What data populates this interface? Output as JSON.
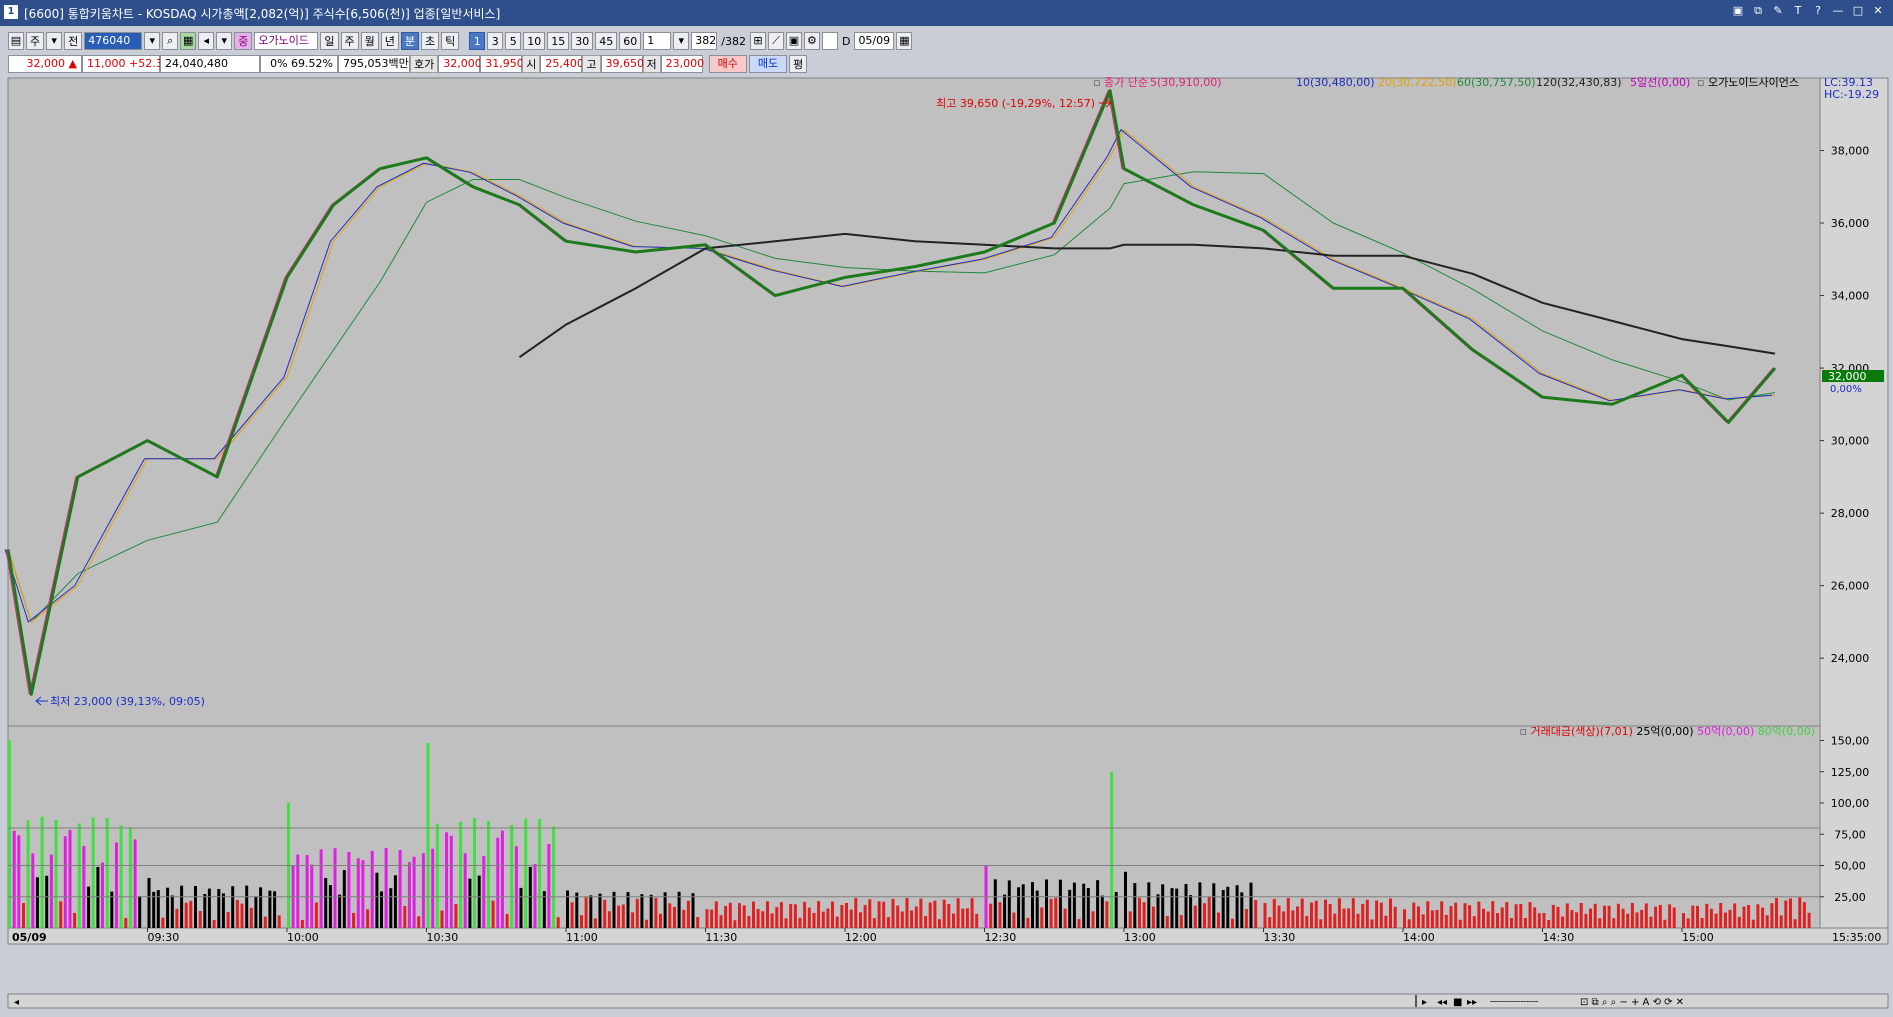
{
  "window": {
    "number": "1",
    "title": "[6600] 통합키움차트 - KOSDAQ 시가총액[2,082(억)] 주식수[6,506(천)] 업종[일반서비스]",
    "buttons": [
      "▣",
      "⧉",
      "✎",
      "T",
      "?",
      "—",
      "□",
      "✕"
    ]
  },
  "toolbar": {
    "period_select": "주",
    "prev_label": "전",
    "code": "476040",
    "name": "오가노이드",
    "badge": "중",
    "periods": [
      "일",
      "주",
      "월",
      "년",
      "분",
      "초",
      "틱"
    ],
    "selected_period": "분",
    "intervals": [
      "1",
      "3",
      "5",
      "10",
      "15",
      "30",
      "45",
      "60"
    ],
    "selected_interval": "1",
    "count_value": "1",
    "bar_count": "382",
    "bar_total": "/382",
    "date": "05/09",
    "checkbox_label": "D"
  },
  "quote": {
    "price": "32,000",
    "change": "11,000",
    "change_pct": "+52.38%",
    "volume": "24,040,480",
    "turnover_label": "0%",
    "turnover_pct": "69.52%",
    "amount": "795,053백만",
    "bid_label": "호가",
    "bid": "32,000",
    "ask": "31,950",
    "open_label": "시",
    "open": "25,400",
    "high_label": "고",
    "high": "39,650",
    "low_label": "저",
    "low": "23,000",
    "buy_label": "매수",
    "sell_label": "매도",
    "extra_label": "평"
  },
  "price_legend": {
    "prefix": "종가 단순",
    "items": [
      {
        "text": "5(30,910,00)",
        "color": "#e0207a"
      },
      {
        "text": "10(30,480,00)",
        "color": "#1a2ec8"
      },
      {
        "text": "20(30,722,50)",
        "color": "#e8a000"
      },
      {
        "text": "60(30,757,50)",
        "color": "#1f8a3c"
      },
      {
        "text": "120(32,430,83)",
        "color": "#222222"
      },
      {
        "text": "5일선(0,00)",
        "color": "#c000c0"
      },
      {
        "text": "오가노이드사이언스",
        "color": "#000000"
      }
    ],
    "lc": "LC:39.13",
    "hc": "HC:-19.29"
  },
  "volume_legend": {
    "items": [
      {
        "text": "거래대금(색상)(7,01)",
        "color": "#e00000"
      },
      {
        "text": "25억(0,00)",
        "color": "#000000"
      },
      {
        "text": "50억(0,00)",
        "color": "#e020e0"
      },
      {
        "text": "80억(0,00)",
        "color": "#40d040"
      }
    ]
  },
  "annotations": {
    "high": "최고 39,650 (-19,29%, 12:57)",
    "low": "최저 23,000 (39,13%, 09:05)",
    "last_price": "32,000",
    "last_pct": "0,00%"
  },
  "axis": {
    "price_ticks": [
      "38,000",
      "36,000",
      "34,000",
      "32,000",
      "30,000",
      "28,000",
      "26,000",
      "24,000"
    ],
    "volume_ticks": [
      "150,00",
      "125,00",
      "100,00",
      "75,00",
      "50,00",
      "25,00"
    ],
    "time_labels": [
      "05/09",
      "09:30",
      "10:00",
      "10:30",
      "11:00",
      "11:30",
      "12:00",
      "12:30",
      "13:00",
      "13:30",
      "14:00",
      "14:30",
      "15:00",
      "15:35:00"
    ]
  },
  "colors": {
    "chart_bg": "#c0c0c0",
    "price_line": "#1c7a1c",
    "ma5": "#e0207a",
    "ma10": "#1a2ec8",
    "ma20": "#e8a000",
    "ma60": "#1f8a3c",
    "ma120": "#222222",
    "vol_red": "#e02020",
    "vol_black": "#000000",
    "vol_magenta": "#e020e0",
    "vol_green": "#40e040"
  },
  "chart_data": [
    {
      "type": "line",
      "title": "",
      "x": [
        "09:00",
        "09:05",
        "09:15",
        "09:30",
        "09:45",
        "10:00",
        "10:10",
        "10:20",
        "10:30",
        "10:40",
        "10:50",
        "11:00",
        "11:15",
        "11:30",
        "11:45",
        "12:00",
        "12:15",
        "12:30",
        "12:45",
        "12:57",
        "13:00",
        "13:15",
        "13:30",
        "13:45",
        "14:00",
        "14:15",
        "14:30",
        "14:45",
        "15:00",
        "15:10",
        "15:20"
      ],
      "series": [
        {
          "name": "종가",
          "values": [
            27000,
            23000,
            29000,
            30000,
            29000,
            34500,
            36500,
            37500,
            37800,
            37000,
            36500,
            35500,
            35200,
            35400,
            34000,
            34500,
            34800,
            35200,
            36000,
            39650,
            37500,
            36500,
            35800,
            34200,
            34200,
            32500,
            31200,
            31000,
            31800,
            30500,
            32000
          ]
        },
        {
          "name": "120",
          "values": [
            null,
            null,
            null,
            null,
            null,
            null,
            null,
            null,
            null,
            null,
            32300,
            33200,
            34200,
            35300,
            35500,
            35700,
            35500,
            35400,
            35300,
            35300,
            35400,
            35400,
            35300,
            35100,
            35100,
            34600,
            33800,
            33300,
            32800,
            32600,
            32400
          ]
        }
      ],
      "ylim": [
        23000,
        40000
      ]
    },
    {
      "type": "bar",
      "title": "거래대금",
      "categories": [
        "09:00",
        "09:30",
        "10:00",
        "10:30",
        "11:00",
        "11:30",
        "12:00",
        "12:30",
        "12:57",
        "13:00",
        "13:30",
        "14:00",
        "14:30",
        "15:00",
        "15:20"
      ],
      "values": [
        150,
        40,
        100,
        148,
        30,
        15,
        20,
        50,
        125,
        45,
        20,
        15,
        12,
        12,
        24
      ],
      "ylim": [
        0,
        160
      ]
    }
  ]
}
